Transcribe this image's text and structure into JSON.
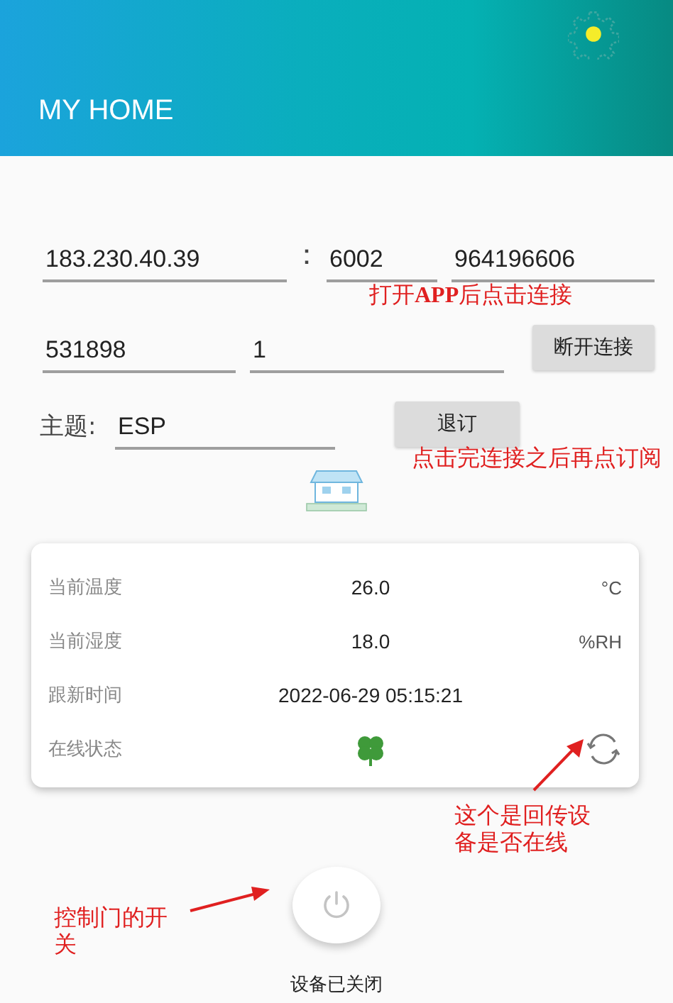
{
  "app_bar": {
    "title": "MY HOME"
  },
  "connection": {
    "host": "183.230.40.39",
    "separator": "：",
    "port": "6002",
    "device_id": "964196606",
    "product_id": "531898",
    "field_5": "1",
    "disconnect_button": "断开连接"
  },
  "topic": {
    "label": "主题:",
    "value": "ESP",
    "unsubscribe_button": "退订"
  },
  "readings": [
    {
      "label": "当前温度",
      "value": "26.0",
      "unit": "°C"
    },
    {
      "label": "当前湿度",
      "value": "18.0",
      "unit": "%RH"
    },
    {
      "label": "跟新时间",
      "value": "2022-06-29 05:15:21"
    }
  ],
  "status": {
    "label": "在线状态",
    "online": true
  },
  "power": {
    "on": false,
    "label": "设备已关闭"
  },
  "annotations": [
    {
      "text": "打开**APP**后点击连接"
    },
    {
      "text": "点击完连接之后再点订阅"
    },
    {
      "text": "这个是回传设备是否在线"
    },
    {
      "text": "控制门的开关"
    }
  ]
}
